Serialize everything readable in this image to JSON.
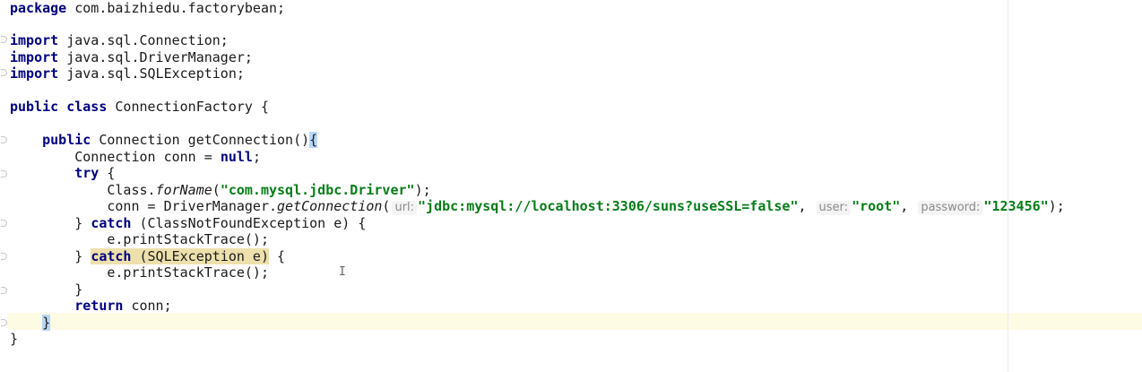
{
  "editor": {
    "lines": [
      {
        "id": "l1",
        "tokens": [
          {
            "k": "kw",
            "t": "package"
          },
          {
            "k": "plain",
            "t": " com.baizhiedu.factorybean;"
          }
        ]
      },
      {
        "id": "l2",
        "tokens": []
      },
      {
        "id": "l3",
        "tokens": [
          {
            "k": "kw",
            "t": "import"
          },
          {
            "k": "plain",
            "t": " java.sql.Connection;"
          }
        ]
      },
      {
        "id": "l4",
        "tokens": [
          {
            "k": "kw",
            "t": "import"
          },
          {
            "k": "plain",
            "t": " java.sql.DriverManager;"
          }
        ]
      },
      {
        "id": "l5",
        "tokens": [
          {
            "k": "kw",
            "t": "import"
          },
          {
            "k": "plain",
            "t": " java.sql.SQLException;"
          }
        ]
      },
      {
        "id": "l6",
        "tokens": []
      },
      {
        "id": "l7",
        "tokens": [
          {
            "k": "kw",
            "t": "public class"
          },
          {
            "k": "plain",
            "t": " ConnectionFactory {"
          }
        ]
      },
      {
        "id": "l8",
        "tokens": []
      },
      {
        "id": "l9",
        "tokens": [
          {
            "k": "plain",
            "t": "    "
          },
          {
            "k": "kw",
            "t": "public"
          },
          {
            "k": "plain",
            "t": " Connection getConnection()"
          },
          {
            "k": "brace",
            "t": "{"
          }
        ]
      },
      {
        "id": "l10",
        "tokens": [
          {
            "k": "plain",
            "t": "        Connection conn = "
          },
          {
            "k": "kw",
            "t": "null"
          },
          {
            "k": "plain",
            "t": ";"
          }
        ]
      },
      {
        "id": "l11",
        "tokens": [
          {
            "k": "plain",
            "t": "        "
          },
          {
            "k": "kw",
            "t": "try"
          },
          {
            "k": "plain",
            "t": " {"
          }
        ]
      },
      {
        "id": "l12",
        "tokens": [
          {
            "k": "plain",
            "t": "            Class."
          },
          {
            "k": "it",
            "t": "forName"
          },
          {
            "k": "plain",
            "t": "("
          },
          {
            "k": "str",
            "t": "\"com.mysql.jdbc.Drirver\""
          },
          {
            "k": "plain",
            "t": ");"
          }
        ]
      },
      {
        "id": "l13",
        "tokens": [
          {
            "k": "plain",
            "t": "            conn = DriverManager."
          },
          {
            "k": "it",
            "t": "getConnection"
          },
          {
            "k": "plain",
            "t": "("
          },
          {
            "k": "hint",
            "t": "url:"
          },
          {
            "k": "str",
            "t": "\"jdbc:mysql://localhost:3306/suns?useSSL=false\""
          },
          {
            "k": "plain",
            "t": ", "
          },
          {
            "k": "hint",
            "t": "user:"
          },
          {
            "k": "str",
            "t": "\"root\""
          },
          {
            "k": "plain",
            "t": ", "
          },
          {
            "k": "hint",
            "t": "password:"
          },
          {
            "k": "str",
            "t": "\"123456\""
          },
          {
            "k": "plain",
            "t": ");"
          }
        ]
      },
      {
        "id": "l14",
        "tokens": [
          {
            "k": "plain",
            "t": "        } "
          },
          {
            "k": "kw",
            "t": "catch"
          },
          {
            "k": "plain",
            "t": " (ClassNotFoundException e) {"
          }
        ]
      },
      {
        "id": "l15",
        "tokens": [
          {
            "k": "plain",
            "t": "            e.printStackTrace();"
          }
        ]
      },
      {
        "id": "l16",
        "tokens": [
          {
            "k": "plain",
            "t": "        } "
          },
          {
            "k": "kwmatch",
            "t": "catch"
          },
          {
            "k": "match",
            "t": " (SQLException e)"
          },
          {
            "k": "plain",
            "t": " {"
          }
        ]
      },
      {
        "id": "l17",
        "tokens": [
          {
            "k": "plain",
            "t": "            e.printStackTrace();"
          }
        ]
      },
      {
        "id": "l18",
        "tokens": [
          {
            "k": "plain",
            "t": "        }"
          }
        ]
      },
      {
        "id": "l19",
        "tokens": [
          {
            "k": "plain",
            "t": "        "
          },
          {
            "k": "kw",
            "t": "return"
          },
          {
            "k": "plain",
            "t": " conn;"
          }
        ]
      },
      {
        "id": "l20",
        "tokens": [
          {
            "k": "plain",
            "t": "    "
          },
          {
            "k": "brace",
            "t": "}"
          }
        ]
      },
      {
        "id": "l21",
        "tokens": [
          {
            "k": "plain",
            "t": "}"
          }
        ]
      }
    ]
  },
  "cursor": {
    "glyph": "I",
    "icon": "text-cursor-icon"
  },
  "colors": {
    "keyword": "#000080",
    "string": "#067d17",
    "current_line": "#fdfbe4",
    "match_highlight": "#ede0ad",
    "brace_highlight": "#b7d7f7"
  }
}
